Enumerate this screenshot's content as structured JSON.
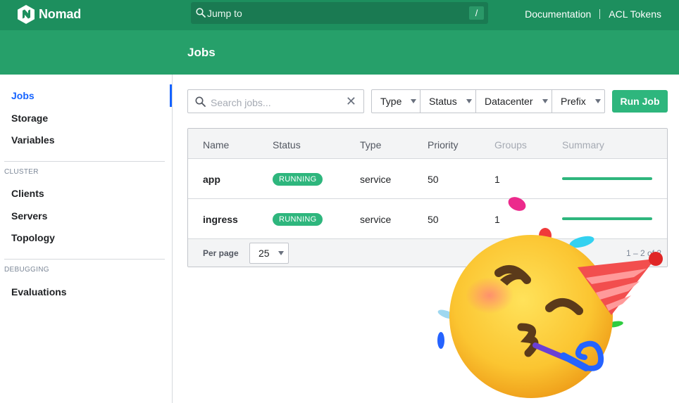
{
  "topnav": {
    "brand": "Nomad",
    "search_label": "Jump to",
    "search_shortcut": "/",
    "links": [
      "Documentation",
      "ACL Tokens"
    ],
    "background_color": "#1d8f5e"
  },
  "page": {
    "title": "Jobs",
    "header_color": "#26a06a"
  },
  "sidebar": {
    "items": [
      {
        "label": "Jobs",
        "active": true
      },
      {
        "label": "Storage"
      },
      {
        "label": "Variables"
      }
    ],
    "cluster_heading": "CLUSTER",
    "cluster_items": [
      "Clients",
      "Servers",
      "Topology"
    ],
    "debugging_heading": "DEBUGGING",
    "debugging_items": [
      "Evaluations"
    ],
    "active_color": "#1563ff"
  },
  "toolbar": {
    "search_placeholder": "Search jobs...",
    "clear_icon": "close-icon",
    "filters": [
      "Type",
      "Status",
      "Datacenter",
      "Prefix"
    ],
    "run_job_label": "Run Job",
    "accent_color": "#2eb67d"
  },
  "table": {
    "columns": [
      "Name",
      "Status",
      "Type",
      "Priority",
      "Groups",
      "Summary"
    ],
    "rows": [
      {
        "name": "app",
        "status": "RUNNING",
        "type": "service",
        "priority": "50",
        "groups": "1",
        "summary_fraction": 1.0
      },
      {
        "name": "ingress",
        "status": "RUNNING",
        "type": "service",
        "priority": "50",
        "groups": "1",
        "summary_fraction": 1.0
      }
    ],
    "per_page_label": "Per page",
    "per_page_value": "25",
    "pagination_text": "1 – 2 of 2"
  },
  "overlay": {
    "icon": "party-face-emoji-icon"
  }
}
